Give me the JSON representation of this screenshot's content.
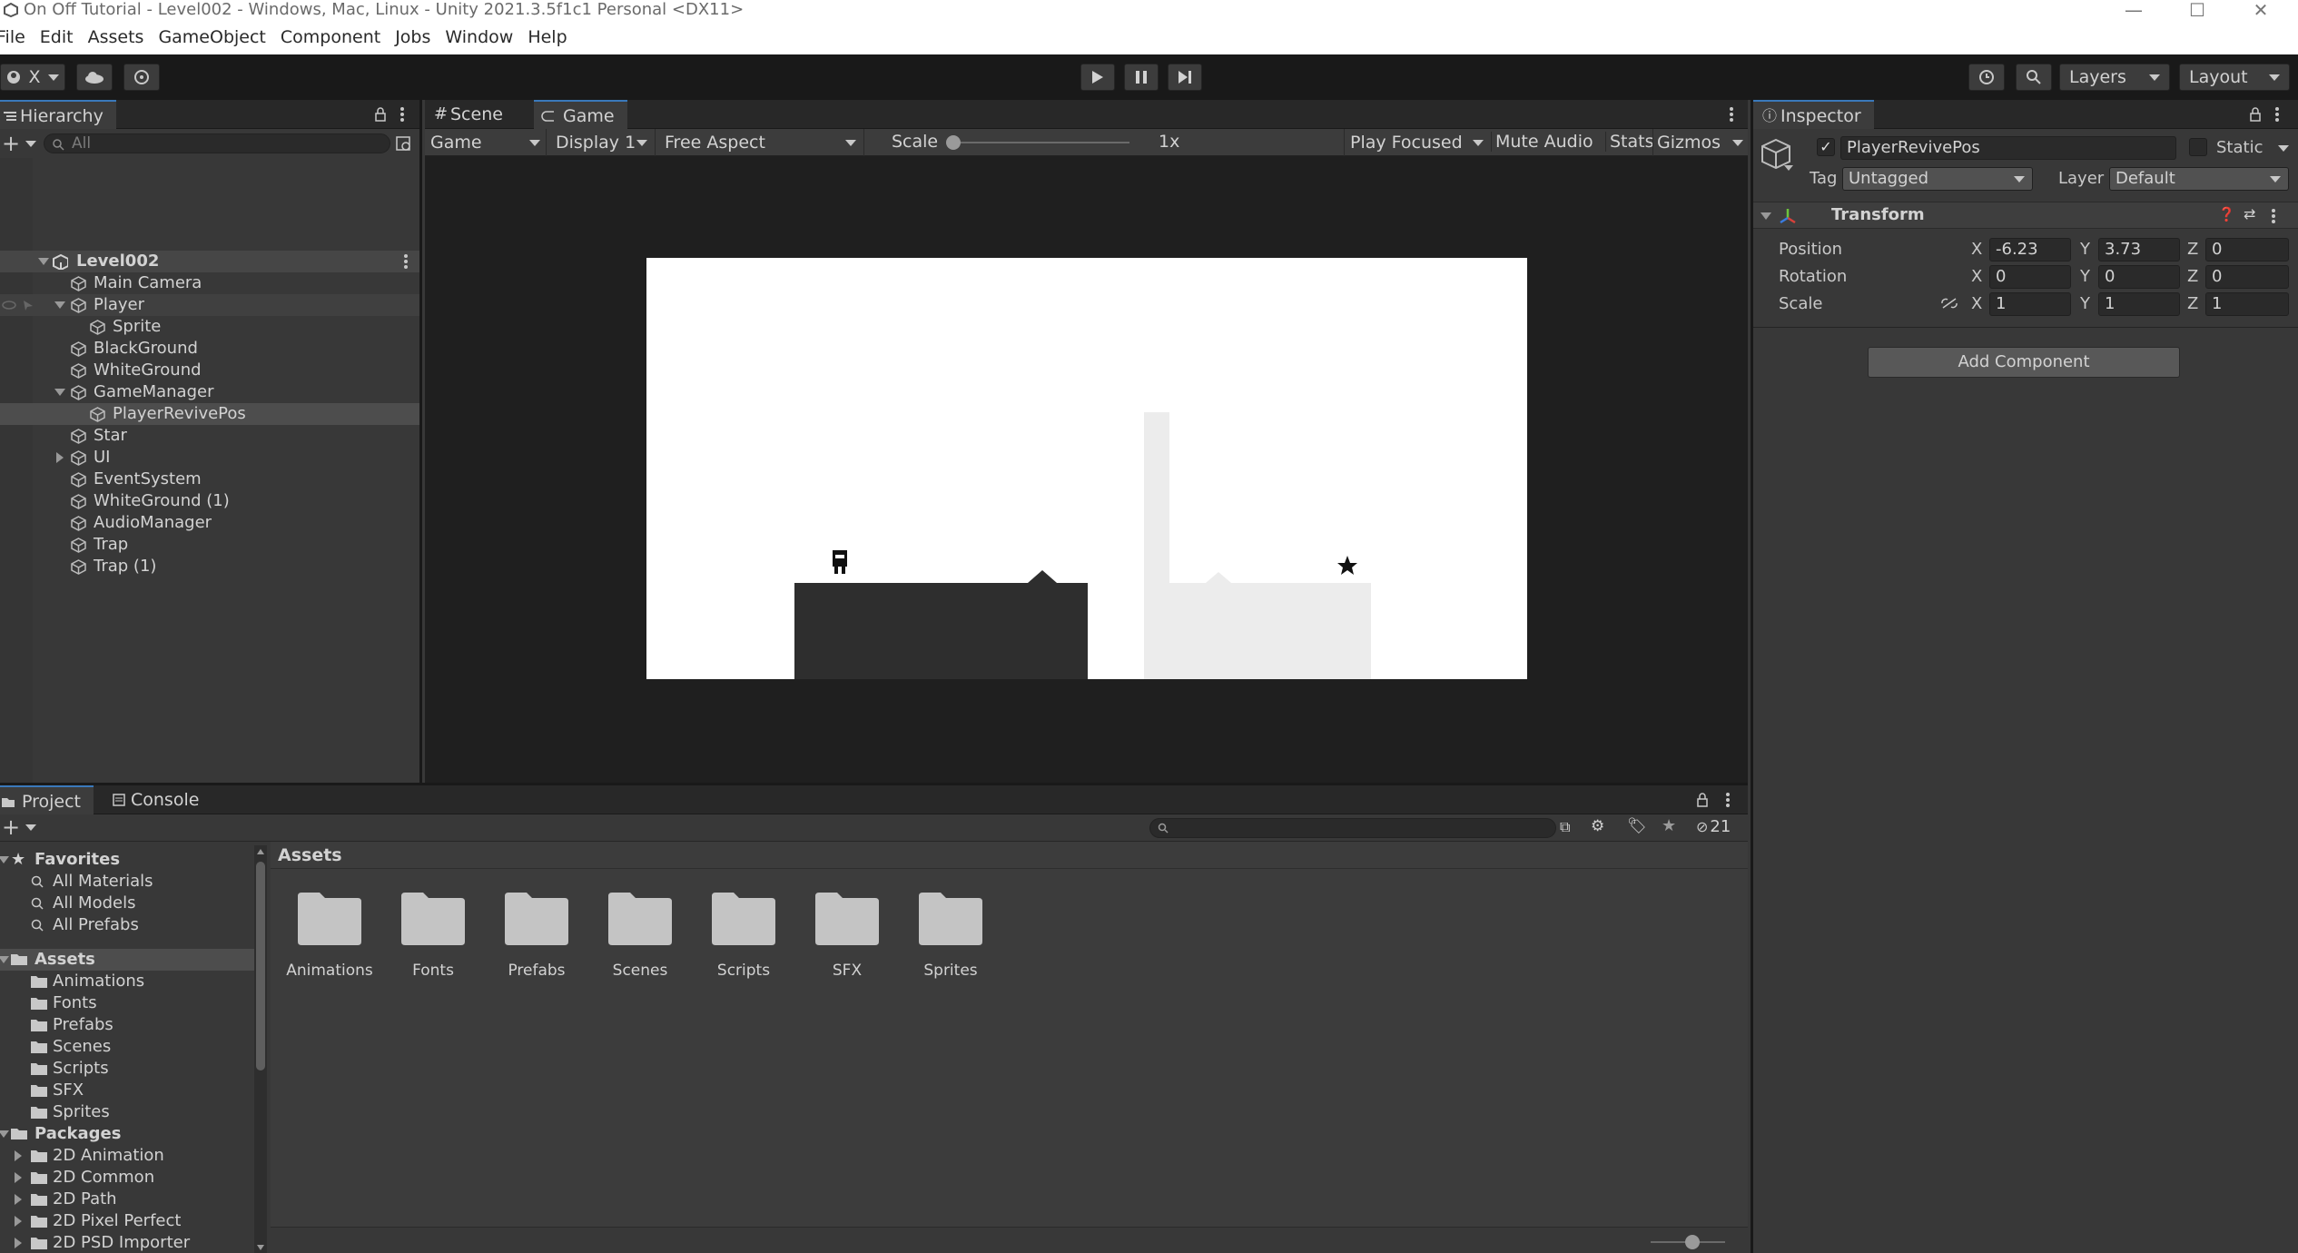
{
  "window": {
    "title": "On Off Tutorial - Level002 - Windows, Mac, Linux - Unity 2021.3.5f1c1 Personal <DX11>"
  },
  "menu": [
    "File",
    "Edit",
    "Assets",
    "GameObject",
    "Component",
    "Jobs",
    "Window",
    "Help"
  ],
  "toolbar": {
    "account_label": "X",
    "layers_label": "Layers",
    "layout_label": "Layout"
  },
  "hierarchy": {
    "tab": "Hierarchy",
    "search_placeholder": "All",
    "scene": "Level002",
    "items": [
      {
        "name": "Main Camera"
      },
      {
        "name": "Player"
      },
      {
        "name": "Sprite"
      },
      {
        "name": "BlackGround"
      },
      {
        "name": "WhiteGround"
      },
      {
        "name": "GameManager"
      },
      {
        "name": "PlayerRevivePos"
      },
      {
        "name": "Star"
      },
      {
        "name": "UI"
      },
      {
        "name": "EventSystem"
      },
      {
        "name": "WhiteGround (1)"
      },
      {
        "name": "AudioManager"
      },
      {
        "name": "Trap"
      },
      {
        "name": "Trap (1)"
      }
    ]
  },
  "game_view": {
    "tabs": [
      "Scene",
      "Game"
    ],
    "mode": "Game",
    "display": "Display 1",
    "aspect": "Free Aspect",
    "scale_label": "Scale",
    "scale_value": "1x",
    "play_focused": "Play Focused",
    "mute_audio": "Mute Audio",
    "stats": "Stats",
    "gizmos": "Gizmos"
  },
  "inspector": {
    "tab": "Inspector",
    "object_name": "PlayerRevivePos",
    "static_label": "Static",
    "tag_label": "Tag",
    "tag_value": "Untagged",
    "layer_label": "Layer",
    "layer_value": "Default",
    "component": "Transform",
    "position_label": "Position",
    "rotation_label": "Rotation",
    "scale_label": "Scale",
    "axis_x": "X",
    "axis_y": "Y",
    "axis_z": "Z",
    "position": {
      "x": "-6.23",
      "y": "3.73",
      "z": "0"
    },
    "rotation": {
      "x": "0",
      "y": "0",
      "z": "0"
    },
    "scale": {
      "x": "1",
      "y": "1",
      "z": "1"
    },
    "add_component": "Add Component"
  },
  "project": {
    "tabs": [
      "Project",
      "Console"
    ],
    "hidden_count": "21",
    "breadcrumb": "Assets",
    "favorites_label": "Favorites",
    "favorites": [
      "All Materials",
      "All Models",
      "All Prefabs"
    ],
    "assets_label": "Assets",
    "asset_folders": [
      "Animations",
      "Fonts",
      "Prefabs",
      "Scenes",
      "Scripts",
      "SFX",
      "Sprites"
    ],
    "packages_label": "Packages",
    "packages": [
      "2D Animation",
      "2D Common",
      "2D Path",
      "2D Pixel Perfect",
      "2D PSD Importer"
    ],
    "grid_folders": [
      "Animations",
      "Fonts",
      "Prefabs",
      "Scenes",
      "Scripts",
      "SFX",
      "Sprites"
    ]
  }
}
